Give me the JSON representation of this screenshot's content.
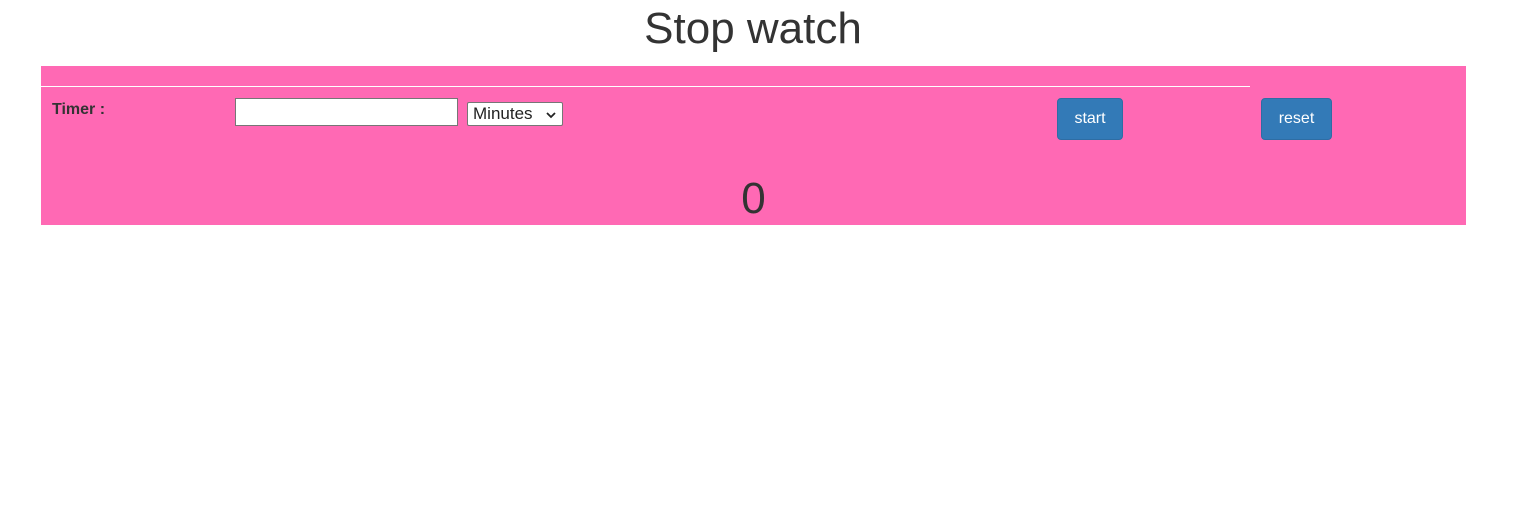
{
  "page": {
    "title": "Stop watch"
  },
  "timer": {
    "label": "Timer :",
    "input_value": "",
    "input_placeholder": "",
    "unit_selected": "Minutes",
    "unit_icon": "chevron-down-icon"
  },
  "controls": {
    "start_label": "start",
    "reset_label": "reset"
  },
  "display": {
    "value": "0"
  },
  "colors": {
    "panel_background": "#ff69b4",
    "button_background": "#337ab7",
    "button_text": "#ffffff",
    "text": "#333333"
  }
}
